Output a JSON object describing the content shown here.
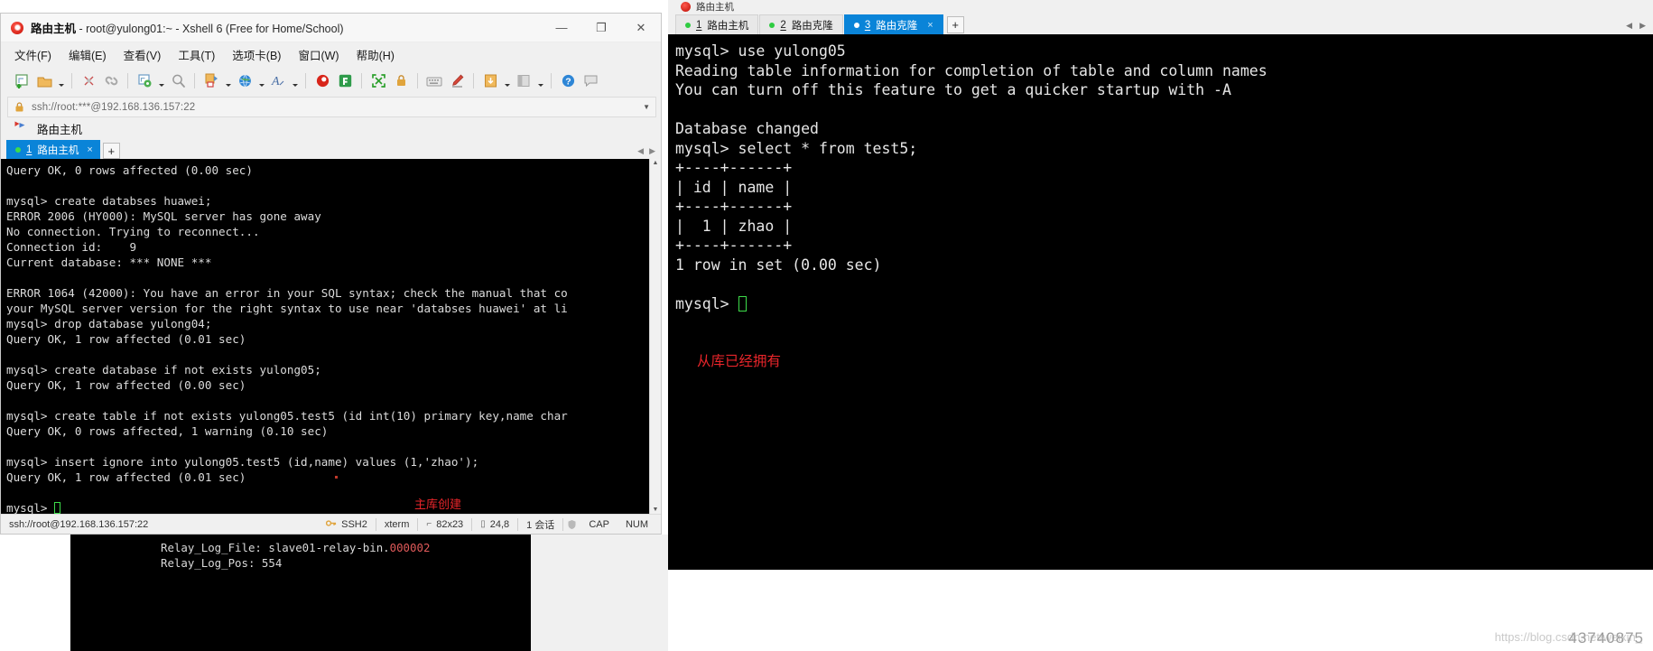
{
  "xshell": {
    "window_title_project": "路由主机",
    "window_title_rest": " - root@yulong01:~ - Xshell 6 (Free for Home/School)",
    "window_buttons": {
      "minimize": "—",
      "maximize": "❐",
      "close": "✕"
    },
    "menu": [
      {
        "label": "文件(F)",
        "name": "menu-file"
      },
      {
        "label": "编辑(E)",
        "name": "menu-edit"
      },
      {
        "label": "查看(V)",
        "name": "menu-view"
      },
      {
        "label": "工具(T)",
        "name": "menu-tools"
      },
      {
        "label": "选项卡(B)",
        "name": "menu-tabs"
      },
      {
        "label": "窗口(W)",
        "name": "menu-window"
      },
      {
        "label": "帮助(H)",
        "name": "menu-help"
      }
    ],
    "toolbar_icons": [
      "new-session-icon",
      "open-folder-icon",
      "dropdown-caret",
      "separator",
      "disconnect-icon",
      "reconnect-icon",
      "separator",
      "properties-icon",
      "dropdown-caret",
      "find-icon",
      "separator",
      "transfer-file-icon",
      "dropdown-caret",
      "globe-icon",
      "dropdown-caret",
      "font-icon",
      "dropdown-caret",
      "separator",
      "xshell-icon",
      "xftp-icon",
      "separator",
      "fullscreen-icon",
      "lock-icon",
      "separator",
      "keyboard-icon",
      "highlight-icon",
      "separator",
      "log-icon",
      "dropdown-caret",
      "layout-icon",
      "dropdown-caret",
      "separator",
      "help-icon",
      "chat-icon"
    ],
    "address": {
      "value": "ssh://root:***@192.168.136.157:22",
      "lock_icon": "lock-icon",
      "caret_icon": "chevron-down-icon"
    },
    "session_row": {
      "icon": "bookmark-flag-icon",
      "label": "路由主机"
    },
    "tab": {
      "index": "1",
      "label": "路由主机",
      "close": "×",
      "add": "+"
    },
    "tab_nav": {
      "prev": "◀",
      "next": "▶",
      "menu": "▾"
    },
    "terminal_lines": [
      "Query OK, 0 rows affected (0.00 sec)",
      "",
      "mysql> create databses huawei;",
      "ERROR 2006 (HY000): MySQL server has gone away",
      "No connection. Trying to reconnect...",
      "Connection id:    9",
      "Current database: *** NONE ***",
      "",
      "ERROR 1064 (42000): You have an error in your SQL syntax; check the manual that co",
      "your MySQL server version for the right syntax to use near 'databses huawei' at li",
      "mysql> drop database yulong04;",
      "Query OK, 1 row affected (0.01 sec)",
      "",
      "mysql> create database if not exists yulong05;",
      "Query OK, 1 row affected (0.00 sec)",
      "",
      "mysql> create table if not exists yulong05.test5 (id int(10) primary key,name char",
      "Query OK, 0 rows affected, 1 warning (0.10 sec)",
      "",
      "mysql> insert ignore into yulong05.test5 (id,name) values (1,'zhao');",
      "Query OK, 1 row affected (0.01 sec)",
      "",
      "mysql> "
    ],
    "annotation": "主库创建",
    "annotation_color": "#e8252a",
    "statusbar": {
      "connection": "ssh://root@192.168.136.157:22",
      "protocol": "SSH2",
      "term_type": "xterm",
      "size": "82x23",
      "cursor": "24,8",
      "sessions": "1 会话",
      "cap": "CAP",
      "num": "NUM",
      "icons": [
        "key-icon",
        "size-icon",
        "cursor-icon",
        "session-icon",
        "shield-icon"
      ]
    }
  },
  "right_window": {
    "title": "路由主机",
    "tabs": [
      {
        "index": "1",
        "label": "路由主机",
        "active": false,
        "dot_color": "#2ecc40"
      },
      {
        "index": "2",
        "label": "路由克隆",
        "active": false,
        "dot_color": "#2ecc40"
      },
      {
        "index": "3",
        "label": "路由克隆",
        "active": true,
        "close": "×",
        "dot_color": "#ffffff"
      }
    ],
    "add_tab": "+",
    "tab_nav": {
      "prev": "◀",
      "next": "▶"
    },
    "terminal_lines": [
      "mysql> use yulong05",
      "Reading table information for completion of table and column names",
      "You can turn off this feature to get a quicker startup with -A",
      "",
      "Database changed",
      "mysql> select * from test5;",
      "+----+------+",
      "| id | name |",
      "+----+------+",
      "|  1 | zhao |",
      "+----+------+",
      "1 row in set (0.00 sec)",
      "",
      "mysql> "
    ],
    "annotation": "从库已经拥有",
    "annotation_color": "#e8252a"
  },
  "bottom_window": {
    "lines": [
      {
        "key": "Relay_Log_File: slave01-relay-bin.",
        "num": "000002"
      },
      {
        "key": "Relay_Log_Pos: 554",
        "num": ""
      }
    ]
  },
  "watermark": {
    "text": "https://blog.csdn.net/weixin_",
    "big": "43740875"
  }
}
